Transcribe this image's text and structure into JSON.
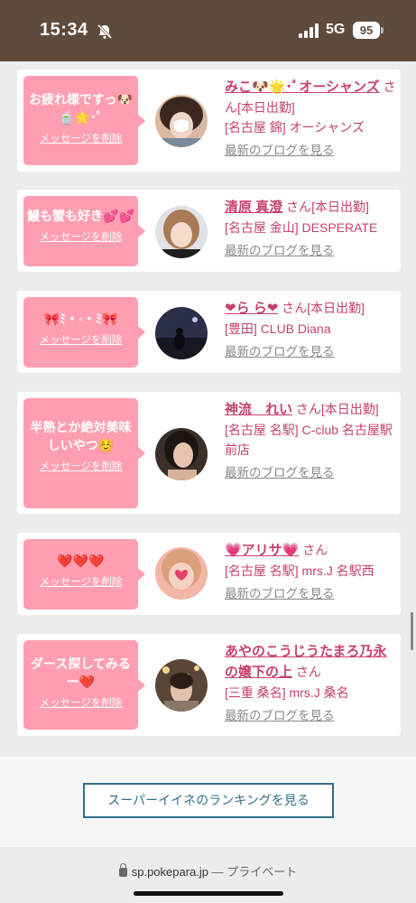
{
  "status": {
    "time": "15:34",
    "network": "5G",
    "battery": "95",
    "icons": [
      "bell-muted-icon",
      "signal-icon",
      "battery-icon"
    ]
  },
  "colors": {
    "status_bg": "#5e4b3c",
    "bubble": "#ff9eb0",
    "name": "#c8416a",
    "button": "#2f6f8a"
  },
  "cards": [
    {
      "message": "お疲れ様ですっ🐶🍵🌟･ﾟ",
      "delete_label": "メッセージを削除",
      "name": "みこ🐶🌟･ﾟオーシャンズ",
      "san": "さん",
      "status": "[本日出勤]",
      "shop": "[名古屋 錦] オーシャンズ",
      "blog": "最新のブログを見る"
    },
    {
      "message": "鰻も蟹も好き💕💕",
      "delete_label": "メッセージを削除",
      "name": "清原 真澄",
      "san": "さん",
      "status": "[本日出勤]",
      "shop": "[名古屋 金山] DESPERATE",
      "blog": "最新のブログを見る"
    },
    {
      "message": "🎀ﾐ・◦・ﾐ🎀",
      "delete_label": "メッセージを削除",
      "name": "❤︎ら ら❤︎",
      "san": "さん",
      "status": "[本日出勤]",
      "shop": "[豊田] CLUB Diana",
      "blog": "最新のブログを見る"
    },
    {
      "message": "半熟とか絶対美味しいやつ☺️",
      "delete_label": "メッセージを削除",
      "name": "神流　れい",
      "san": "さん",
      "status": "[本日出勤]",
      "shop": "[名古屋 名駅] C-club 名古屋駅前店",
      "blog": "最新のブログを見る"
    },
    {
      "message": "❤️❤️❤️",
      "delete_label": "メッセージを削除",
      "name": "💗アリサ💗",
      "san": "さん",
      "status": "",
      "shop": "[名古屋 名駅] mrs.J 名駅西",
      "blog": "最新のブログを見る"
    },
    {
      "message": "ダース探してみるー❤️",
      "delete_label": "メッセージを削除",
      "name": "あやのこうじうたまろ乃永の嬢下の上",
      "san": "さん",
      "status": "",
      "shop": "[三重 桑名] mrs.J 桑名",
      "blog": "最新のブログを見る"
    }
  ],
  "ranking_button": "スーパーイイネのランキングを見る",
  "browser": {
    "url": "sp.pokepara.jp",
    "privacy": "— プライベート"
  }
}
